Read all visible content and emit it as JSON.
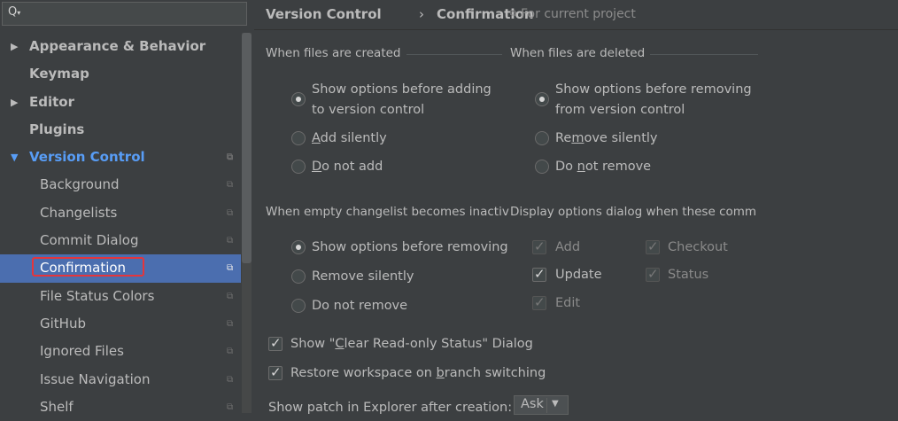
{
  "sidebar": {
    "search_icon": "search-icon",
    "items": [
      {
        "label": "Appearance & Behavior"
      },
      {
        "label": "Keymap"
      },
      {
        "label": "Editor"
      },
      {
        "label": "Plugins"
      },
      {
        "label": "Version Control"
      },
      {
        "label": "Background"
      },
      {
        "label": "Changelists"
      },
      {
        "label": "Commit Dialog"
      },
      {
        "label": "Confirmation"
      },
      {
        "label": "File Status Colors"
      },
      {
        "label": "GitHub"
      },
      {
        "label": "Ignored Files"
      },
      {
        "label": "Issue Navigation"
      },
      {
        "label": "Shelf"
      }
    ]
  },
  "header": {
    "breadcrumb_parent": "Version Control",
    "breadcrumb_sep": "›",
    "breadcrumb_current": "Confirmation",
    "scope_label": "For current project"
  },
  "sections": {
    "created_title": "When files are created",
    "deleted_title": "When files are deleted",
    "empty_changelist_title": "When empty changelist becomes inactiv",
    "display_options_title": "Display options dialog when these comm"
  },
  "created_options": {
    "show_line1": "Show options before adding",
    "show_line2": "to version control",
    "add_prefix": "",
    "add_ul": "A",
    "add_rest": "dd silently",
    "notadd_prefix": "",
    "notadd_ul": "D",
    "notadd_rest": "o not add"
  },
  "deleted_options": {
    "show_line1": "Show options before removing",
    "show_line2": "from version control",
    "remove_prefix": "Re",
    "remove_ul": "m",
    "remove_rest": "ove silently",
    "notremove_prefix": "Do ",
    "notremove_ul": "n",
    "notremove_rest": "ot remove"
  },
  "empty_options": {
    "show": "Show options before removing",
    "remove": "Remove silently",
    "not_remove": "Do not remove"
  },
  "commands": {
    "add": "Add",
    "checkout": "Checkout",
    "update": "Update",
    "status": "Status",
    "edit": "Edit"
  },
  "misc": {
    "clear_ro_prefix": "Show \"",
    "clear_ro_ul": "C",
    "clear_ro_rest": "lear Read-only Status\" Dialog",
    "restore_prefix": "Restore workspace on ",
    "restore_ul": "b",
    "restore_rest": "ranch switching",
    "patch_label": "Show patch in Explorer after creation:",
    "patch_value": "Ask"
  }
}
